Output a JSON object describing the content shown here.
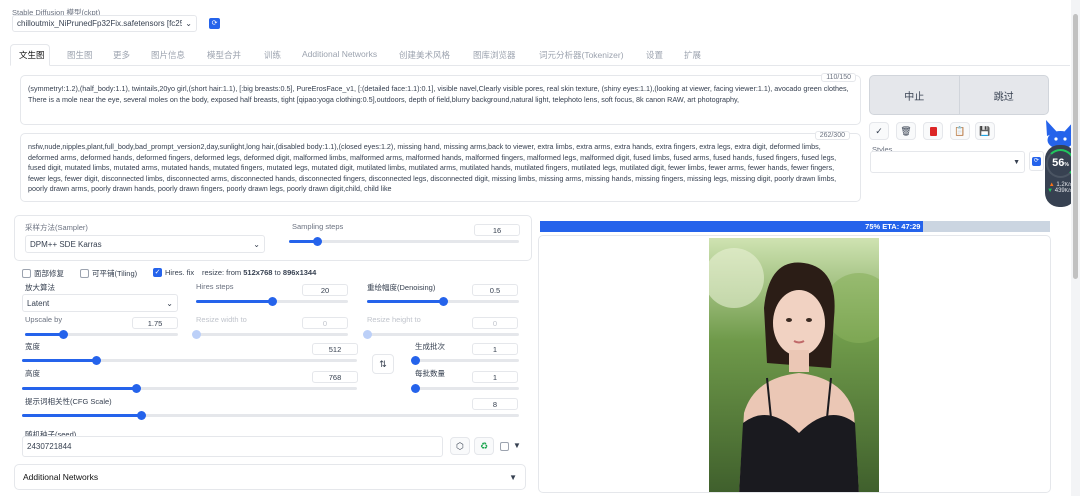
{
  "model": {
    "label": "Stable Diffusion 模型(ckpt)",
    "value": "chilloutmix_NiPrunedFp32Fix.safetensors [fc251",
    "refresh_icon": "refresh-icon"
  },
  "tabs": [
    "文生图",
    "图生图",
    "更多",
    "图片信息",
    "模型合并",
    "训练",
    "Additional Networks",
    "创建美术风格",
    "图库浏览器",
    "词元分析器(Tokenizer)",
    "设置",
    "扩展"
  ],
  "prompt": {
    "counter": "110/150",
    "text": "(symmetry!:1.2),(half_body:1.1), twintails,20yo girl,(short hair:1.1), [:big breasts:0.5], PureErosFace_v1, [:(detailed face:1.1):0.1], visible navel,Clearly visible pores, real skin texture, (shiny eyes:1.1),(looking at viewer, facing viewer:1.1), avocado green clothes, There is a mole near the eye, several moles on the body, exposed half breasts, tight [qipao:yoga clothing:0.5],outdoors, depth of field,blurry background,natural light, telephoto lens, soft focus, 8k canon RAW, art photography,"
  },
  "negative_prompt": {
    "counter": "262/300",
    "text": "nsfw,nude,nipples,plant,full_body,bad_prompt_version2,day,sunlight,long hair,(disabled body:1.1),(closed eyes:1.2), missing hand, missing arms,back to viewer, extra limbs, extra arms, extra hands, extra fingers, extra legs, extra digit, deformed limbs, deformed arms, deformed hands, deformed fingers, deformed legs, deformed digit, malformed limbs, malformed arms, malformed hands, malformed fingers, malformed legs, malformed digit, fused limbs, fused arms, fused hands, fused fingers, fused legs, fused digit, mutated limbs, mutated arms, mutated hands, mutated fingers, mutated legs, mutated digit, mutilated limbs, mutilated arms, mutilated hands, mutilated fingers, mutilated legs, mutilated digit, fewer limbs, fewer arms, fewer hands, fewer fingers, fewer legs, fewer digit, disconnected limbs, disconnected arms, disconnected hands, disconnected fingers, disconnected legs, disconnected digit, missing limbs, missing arms, missing hands, missing fingers, missing legs, missing digit, poorly drawn limbs, poorly drawn arms, poorly drawn hands, poorly drawn fingers, poorly drawn legs, poorly drawn digit,child, child like"
  },
  "actions": {
    "interrupt": "中止",
    "skip": "跳过"
  },
  "tools": [
    "check-icon",
    "trash-icon",
    "red-card-icon",
    "clipboard-icon",
    "save-icon"
  ],
  "styles": {
    "label": "Styles",
    "value": ""
  },
  "sampler": {
    "label": "采样方法(Sampler)",
    "value": "DPM++ SDE Karras"
  },
  "steps": {
    "label": "Sampling steps",
    "value": "16",
    "fraction": 0.12
  },
  "checks": {
    "restore_faces": "面部修复",
    "tiling": "可平铺(Tiling)",
    "hires": "Hires. fix",
    "resize_prefix": "resize: from ",
    "resize_from": "512x768",
    "resize_mid": " to ",
    "resize_to": "896x1344"
  },
  "upscaler": {
    "label": "放大算法",
    "value": "Latent"
  },
  "hires_steps": {
    "label": "Hires steps",
    "value": "20",
    "fraction": 0.5
  },
  "denoise": {
    "label": "重绘幅度(Denoising)",
    "value": "0.5",
    "fraction": 0.5
  },
  "upscale_by": {
    "label": "Upscale by",
    "value": "1.75",
    "fraction": 0.25
  },
  "resize_w": {
    "label": "Resize width to",
    "value": "0",
    "fraction": 0
  },
  "resize_h": {
    "label": "Resize height to",
    "value": "0",
    "fraction": 0
  },
  "width": {
    "label": "宽度",
    "value": "512",
    "fraction": 0.22
  },
  "height": {
    "label": "高度",
    "value": "768",
    "fraction": 0.34
  },
  "batch_count": {
    "label": "生成批次",
    "value": "1",
    "fraction": 0.0
  },
  "batch_size": {
    "label": "每批数量",
    "value": "1",
    "fraction": 0.0
  },
  "cfg": {
    "label": "提示词相关性(CFG Scale)",
    "value": "8",
    "fraction": 0.24
  },
  "seed": {
    "label": "随机种子(seed)",
    "value": "2430721844"
  },
  "additional_networks": "Additional Networks",
  "progress": {
    "text": "75% ETA: 47:29",
    "fraction": 0.75
  },
  "widget": {
    "percent": "56",
    "unit": "%",
    "up": "1.2",
    "up_unit": "K/s",
    "down": "439",
    "down_unit": "K/s"
  },
  "colors": {
    "accent": "#2563eb",
    "orange": "#f97316",
    "green": "#22c55e"
  }
}
